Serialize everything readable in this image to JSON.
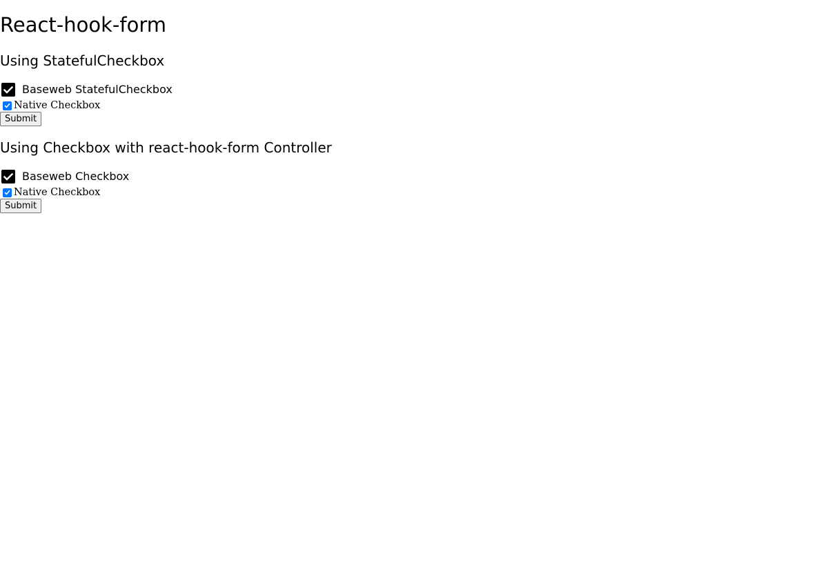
{
  "page": {
    "title": "React-hook-form"
  },
  "sections": [
    {
      "heading": "Using StatefulCheckbox",
      "baseweb_checkbox": {
        "label": "Baseweb StatefulCheckbox",
        "checked": true
      },
      "native_checkbox": {
        "label": "Native Checkbox",
        "checked": true
      },
      "submit_label": "Submit"
    },
    {
      "heading": "Using Checkbox with react-hook-form Controller",
      "baseweb_checkbox": {
        "label": "Baseweb Checkbox",
        "checked": true
      },
      "native_checkbox": {
        "label": "Native Checkbox",
        "checked": true
      },
      "submit_label": "Submit"
    }
  ],
  "icons": {
    "baseweb_check": "check-icon",
    "native_check": "check-icon"
  },
  "colors": {
    "baseweb_checkbox_fill": "#000000",
    "native_checkbox_fill": "#0075ff",
    "button_background": "#efefef",
    "button_border": "#767676"
  }
}
